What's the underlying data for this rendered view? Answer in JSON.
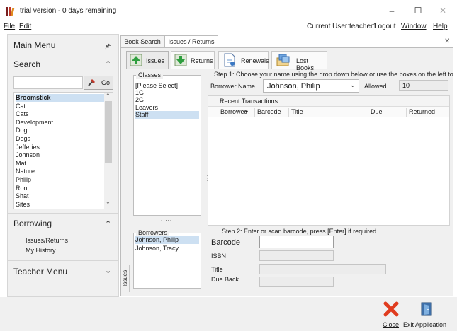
{
  "window": {
    "title": "trial version - 0 days remaining",
    "controls": {
      "minimize": "–",
      "maximize": "☐",
      "close": "✕"
    }
  },
  "menubar": {
    "file": "File",
    "edit": "Edit",
    "current_user": "Current User:teacher1",
    "logout": "Logout",
    "window": "Window",
    "help": "Help"
  },
  "sidebar": {
    "main_menu": "Main Menu",
    "search_heading": "Search",
    "search_value": "",
    "go_label": "Go",
    "topics": [
      "Broomstick",
      "Cat",
      "Cats",
      "Development",
      "Dog",
      "Dogs",
      "Jefferies",
      "Johnson",
      "Mat",
      "Nature",
      "Philip",
      "Ron",
      "Shat",
      "Sites"
    ],
    "borrowing_heading": "Borrowing",
    "borrowing_links": [
      "Issues/Returns",
      "My History"
    ],
    "teacher_menu": "Teacher Menu"
  },
  "tabs": [
    "Book Search",
    "Issues / Returns"
  ],
  "active_tab": "Issues / Returns",
  "toolbar": {
    "issues": "Issues",
    "returns": "Returns",
    "renewals": "Renewals",
    "lost_books": "Lost Books"
  },
  "classes": {
    "title": "Classes",
    "items": [
      "[Please Select]",
      "1G",
      "2G",
      "Leavers",
      "Staff"
    ],
    "selected": "Staff",
    "more": "....."
  },
  "borrowers": {
    "title": "Borrowers",
    "items": [
      "Johnson, Philip",
      "Johnson, Tracy"
    ],
    "selected": "Johnson, Philip"
  },
  "side_label": "Issues",
  "step1": {
    "instruction": "Step 1: Choose your name using the drop down below or use the boxes on the left to",
    "borrower_label": "Borrower Name",
    "borrower_value": "Johnson, Philip",
    "allowed_label": "Allowed",
    "allowed_value": "10"
  },
  "transactions": {
    "title": "Recent Transactions",
    "columns": [
      "Borrowed",
      "Barcode",
      "Title",
      "Due",
      "Returned"
    ],
    "sort_indicator": "▾",
    "rows": []
  },
  "step2": {
    "instruction": "Step 2: Enter or scan barcode, press [Enter] if required.",
    "barcode_label": "Barcode",
    "isbn_label": "ISBN",
    "title_label": "Title",
    "due_back_label": "Due Back"
  },
  "bottom": {
    "close": "Close",
    "exit": "Exit Application"
  }
}
